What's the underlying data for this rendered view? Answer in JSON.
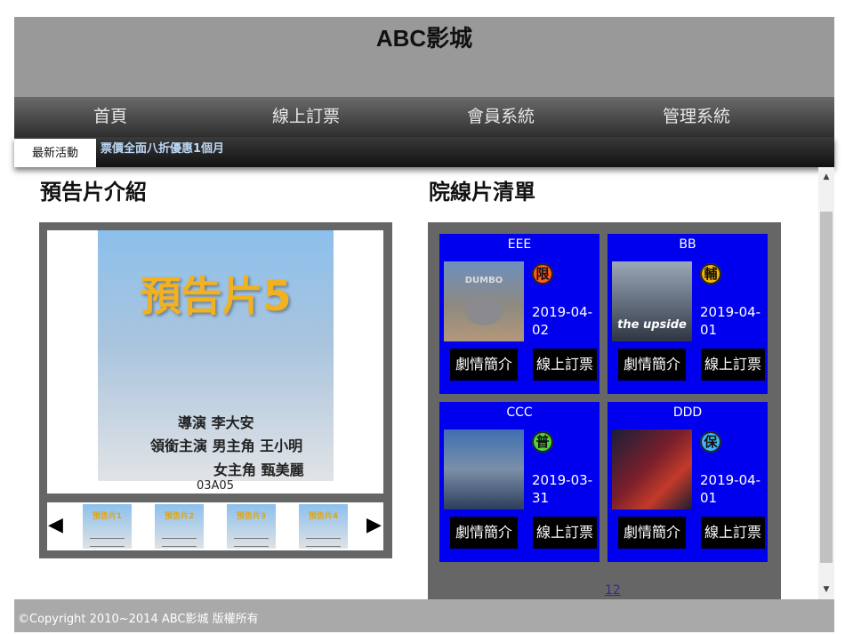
{
  "header": {
    "title": "ABC影城"
  },
  "nav": {
    "items": [
      "首頁",
      "線上訂票",
      "會員系統",
      "管理系統"
    ]
  },
  "ticker": {
    "label": "最新活動",
    "text": "票價全面八折優惠1個月"
  },
  "trailer": {
    "section_title": "預告片介紹",
    "poster_title": "預告片5",
    "credits": [
      "導演 李大安",
      "領銜主演 男主角 王小明",
      "女主角 甄美麗"
    ],
    "caption": "03A05",
    "prev_arrow": "◀",
    "next_arrow": "▶",
    "thumbs": [
      "預告片1",
      "預告片2",
      "預告片3",
      "預告片4"
    ]
  },
  "movies": {
    "section_title": "院線片清單",
    "intro_label": "劇情簡介",
    "order_label": "線上訂票",
    "cards": [
      {
        "name": "EEE",
        "rating": "限",
        "rating_color": "#ff5a1f",
        "date": "2019-04-02",
        "poster": "DUMBO"
      },
      {
        "name": "BB",
        "rating": "輔",
        "rating_color": "#f5b400",
        "date": "2019-04-01",
        "poster": "the upside"
      },
      {
        "name": "CCC",
        "rating": "普",
        "rating_color": "#4fd23c",
        "date": "2019-03-31",
        "poster": ""
      },
      {
        "name": "DDD",
        "rating": "保",
        "rating_color": "#3fb6f5",
        "date": "2019-04-01",
        "poster": ""
      }
    ],
    "pager": "12"
  },
  "footer": {
    "text": "©Copyright 2010~2014 ABC影城 版權所有"
  }
}
